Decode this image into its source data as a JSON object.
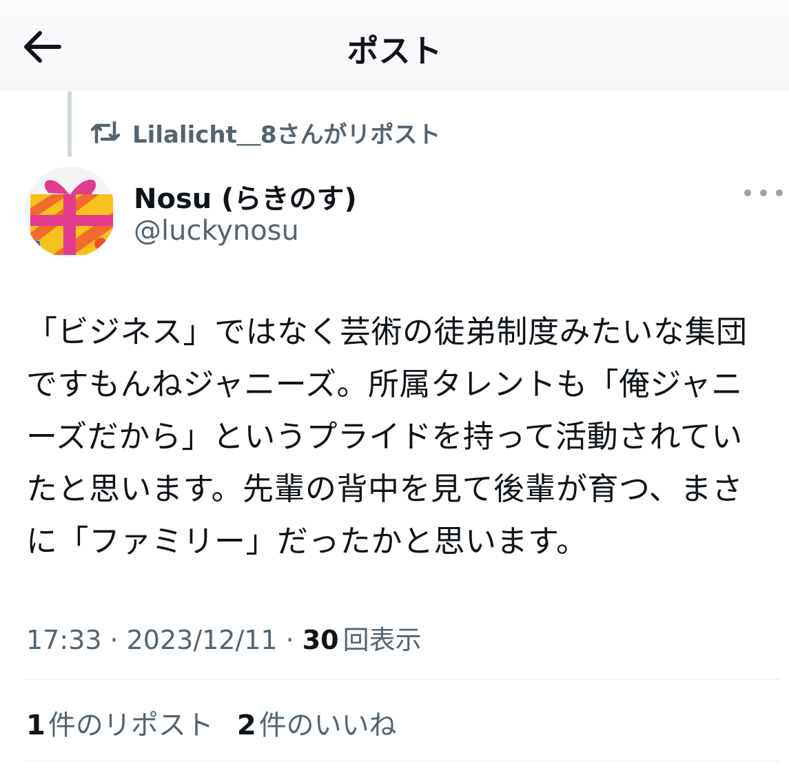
{
  "colors": {
    "text_primary": "#0f1419",
    "text_secondary": "#536471",
    "thread_line": "#cfd9de",
    "divider": "#eff3f4"
  },
  "header": {
    "back_icon": "arrow-left-icon",
    "title": "ポスト"
  },
  "repost": {
    "icon": "repost-icon",
    "text": "Lilalicht＿8さんがリポスト"
  },
  "author": {
    "display_name": "Nosu (らきのす)",
    "handle": "@luckynosu",
    "avatar": "gift-box-avatar",
    "more_icon": "more-dots-icon"
  },
  "post": {
    "lines": [
      "「ビジネス」ではなく芸術の徒弟制度みたいな集団",
      "ですもんねジャニーズ。所属タレントも「俺ジャニ",
      "ーズだから」というプライドを持って活動されてい",
      "たと思います。先輩の背中を見て後輩が育つ、まさ",
      "に「ファミリー」だったかと思います。"
    ]
  },
  "meta": {
    "time": "17:33",
    "separator": "·",
    "date": "2023/12/11",
    "views_count": "30",
    "views_label": "回表示"
  },
  "stats": {
    "reposts_count": "1",
    "reposts_label": "件のリポスト",
    "likes_count": "2",
    "likes_label": "件のいいね"
  }
}
